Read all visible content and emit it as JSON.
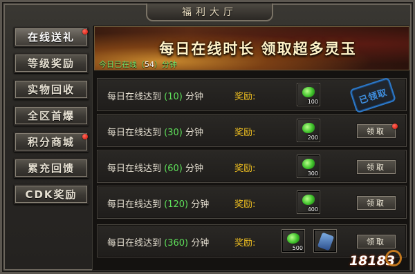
{
  "window": {
    "title": "福利大厅"
  },
  "sidebar": {
    "items": [
      {
        "label": "在线送礼",
        "active": true,
        "badge": true
      },
      {
        "label": "等级奖励",
        "active": false,
        "badge": false
      },
      {
        "label": "实物回收",
        "active": false,
        "badge": false
      },
      {
        "label": "全区首爆",
        "active": false,
        "badge": false
      },
      {
        "label": "积分商城",
        "active": false,
        "badge": true
      },
      {
        "label": "累充回馈",
        "active": false,
        "badge": false
      },
      {
        "label": "CDK奖励",
        "active": false,
        "badge": false
      }
    ]
  },
  "banner": {
    "title": "每日在线时长  领取超多灵玉",
    "online_prefix": "今日已在线（",
    "online_minutes": "54",
    "online_suffix": "）分钟"
  },
  "rows": [
    {
      "prefix": "每日在线达到",
      "minutes": "(10)",
      "unit": "分钟",
      "reward_label": "奖励:",
      "items": [
        {
          "qty": "100",
          "type": "jade"
        }
      ],
      "status": "claimed",
      "status_text": "已领取"
    },
    {
      "prefix": "每日在线达到",
      "minutes": "(30)",
      "unit": "分钟",
      "reward_label": "奖励:",
      "items": [
        {
          "qty": "200",
          "type": "jade"
        }
      ],
      "status": "claim",
      "status_text": "领取",
      "badge": true
    },
    {
      "prefix": "每日在线达到",
      "minutes": "(60)",
      "unit": "分钟",
      "reward_label": "奖励:",
      "items": [
        {
          "qty": "300",
          "type": "jade"
        }
      ],
      "status": "claim",
      "status_text": "领取"
    },
    {
      "prefix": "每日在线达到",
      "minutes": "(120)",
      "unit": "分钟",
      "reward_label": "奖励:",
      "items": [
        {
          "qty": "400",
          "type": "jade"
        }
      ],
      "status": "claim",
      "status_text": "领取"
    },
    {
      "prefix": "每日在线达到",
      "minutes": "(360)",
      "unit": "分钟",
      "reward_label": "奖励:",
      "items": [
        {
          "qty": "500",
          "type": "jade"
        },
        {
          "qty": "",
          "type": "scroll"
        }
      ],
      "status": "claim",
      "status_text": "领取"
    }
  ],
  "watermark": "18183"
}
